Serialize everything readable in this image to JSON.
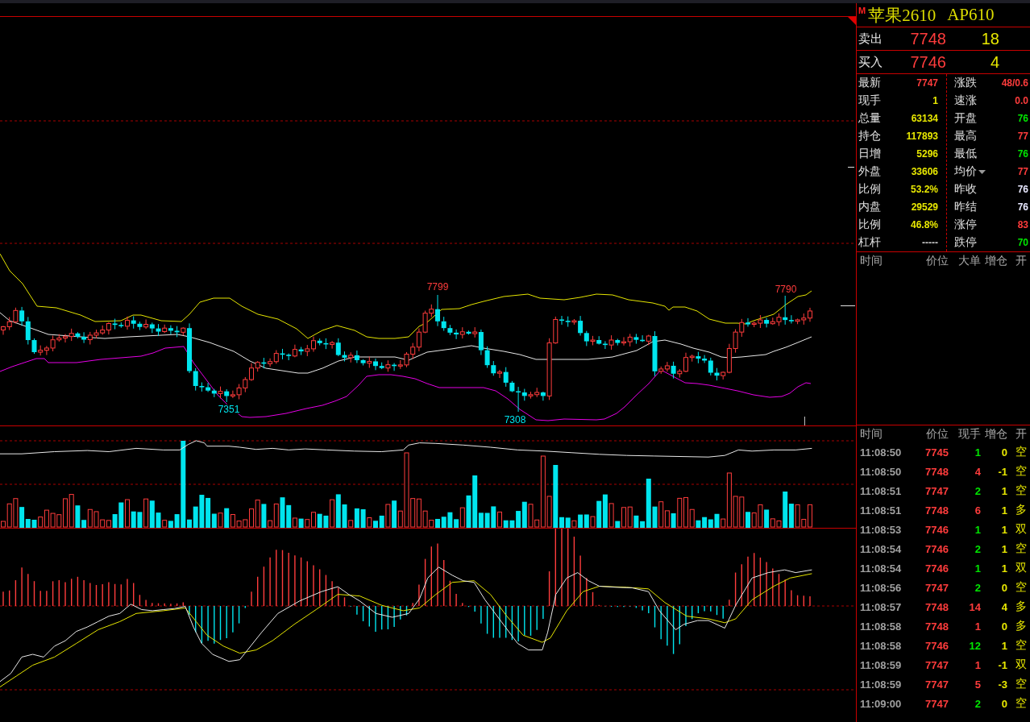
{
  "chart": {
    "price_labels": [
      {
        "text": "7799",
        "kind": "high"
      },
      {
        "text": "7790",
        "kind": "high"
      },
      {
        "text": "7351",
        "kind": "low"
      },
      {
        "text": "7308",
        "kind": "low"
      }
    ]
  },
  "quote_panel": {
    "market": "M",
    "name": "苹果2610",
    "code": "AP610",
    "quotes": [
      {
        "label": "卖出",
        "price": "7748",
        "volume": "18"
      },
      {
        "label": "买入",
        "price": "7746",
        "volume": "4"
      }
    ],
    "stats_left": [
      {
        "label": "最新",
        "value": "7747",
        "color": "#ff3c3c"
      },
      {
        "label": "现手",
        "value": "1",
        "color": "#e8e800"
      },
      {
        "label": "总量",
        "value": "63134",
        "color": "#e8e800"
      },
      {
        "label": "持仓",
        "value": "117893",
        "color": "#e8e800"
      },
      {
        "label": "日增",
        "value": "5296",
        "color": "#e8e800"
      },
      {
        "label": "外盘",
        "value": "33606",
        "color": "#e8e800"
      },
      {
        "label": "比例",
        "value": "53.2%",
        "color": "#e8e800"
      },
      {
        "label": "内盘",
        "value": "29529",
        "color": "#e8e800"
      },
      {
        "label": "比例",
        "value": "46.8%",
        "color": "#e8e800"
      },
      {
        "label": "杠杆",
        "value": "-----",
        "color": "#d0d0d0"
      }
    ],
    "stats_right": [
      {
        "label": "涨跌",
        "value": "48/0.6",
        "color": "#ff3c3c",
        "dropdown": false
      },
      {
        "label": "速涨",
        "value": "0.0",
        "color": "#ff3c3c",
        "dropdown": false
      },
      {
        "label": "开盘",
        "value": "76",
        "color": "#00e600",
        "dropdown": false
      },
      {
        "label": "最高",
        "value": "77",
        "color": "#ff3c3c",
        "dropdown": false
      },
      {
        "label": "最低",
        "value": "76",
        "color": "#00e600",
        "dropdown": false
      },
      {
        "label": "均价",
        "value": "77",
        "color": "#ff3c3c",
        "dropdown": true
      },
      {
        "label": "昨收",
        "value": "76",
        "color": "#e8e8ff",
        "dropdown": false
      },
      {
        "label": "昨结",
        "value": "76",
        "color": "#e8e8ff",
        "dropdown": false
      },
      {
        "label": "涨停",
        "value": "83",
        "color": "#ff3c3c",
        "dropdown": false
      },
      {
        "label": "跌停",
        "value": "70",
        "color": "#00e600",
        "dropdown": false
      }
    ]
  },
  "big_orders": {
    "columns": [
      "时间",
      "价位",
      "大单",
      "增仓",
      "开"
    ]
  },
  "trades": {
    "columns": [
      "时间",
      "价位",
      "现手",
      "增仓",
      "开"
    ],
    "rows": [
      {
        "time": "11:08:50",
        "price": "7745",
        "volume": "1",
        "color": "#00e600",
        "oi_change": "0",
        "type": "空"
      },
      {
        "time": "11:08:50",
        "price": "7748",
        "volume": "4",
        "color": "#ff3c3c",
        "oi_change": "-1",
        "type": "空"
      },
      {
        "time": "11:08:51",
        "price": "7747",
        "volume": "2",
        "color": "#00e600",
        "oi_change": "1",
        "type": "空"
      },
      {
        "time": "11:08:51",
        "price": "7748",
        "volume": "6",
        "color": "#ff3c3c",
        "oi_change": "1",
        "type": "多"
      },
      {
        "time": "11:08:53",
        "price": "7746",
        "volume": "1",
        "color": "#00e600",
        "oi_change": "1",
        "type": "双"
      },
      {
        "time": "11:08:54",
        "price": "7746",
        "volume": "2",
        "color": "#00e600",
        "oi_change": "1",
        "type": "空"
      },
      {
        "time": "11:08:54",
        "price": "7746",
        "volume": "1",
        "color": "#00e600",
        "oi_change": "1",
        "type": "双"
      },
      {
        "time": "11:08:56",
        "price": "7747",
        "volume": "2",
        "color": "#00e600",
        "oi_change": "0",
        "type": "空"
      },
      {
        "time": "11:08:57",
        "price": "7748",
        "volume": "14",
        "color": "#ff3c3c",
        "oi_change": "4",
        "type": "多"
      },
      {
        "time": "11:08:58",
        "price": "7748",
        "volume": "1",
        "color": "#ff3c3c",
        "oi_change": "0",
        "type": "多"
      },
      {
        "time": "11:08:58",
        "price": "7746",
        "volume": "12",
        "color": "#00e600",
        "oi_change": "1",
        "type": "空"
      },
      {
        "time": "11:08:59",
        "price": "7747",
        "volume": "1",
        "color": "#ff3c3c",
        "oi_change": "-1",
        "type": "双"
      },
      {
        "time": "11:08:59",
        "price": "7747",
        "volume": "5",
        "color": "#ff3c3c",
        "oi_change": "-3",
        "type": "空"
      },
      {
        "time": "11:09:00",
        "price": "7747",
        "volume": "2",
        "color": "#00e600",
        "oi_change": "0",
        "type": "空"
      }
    ]
  }
}
